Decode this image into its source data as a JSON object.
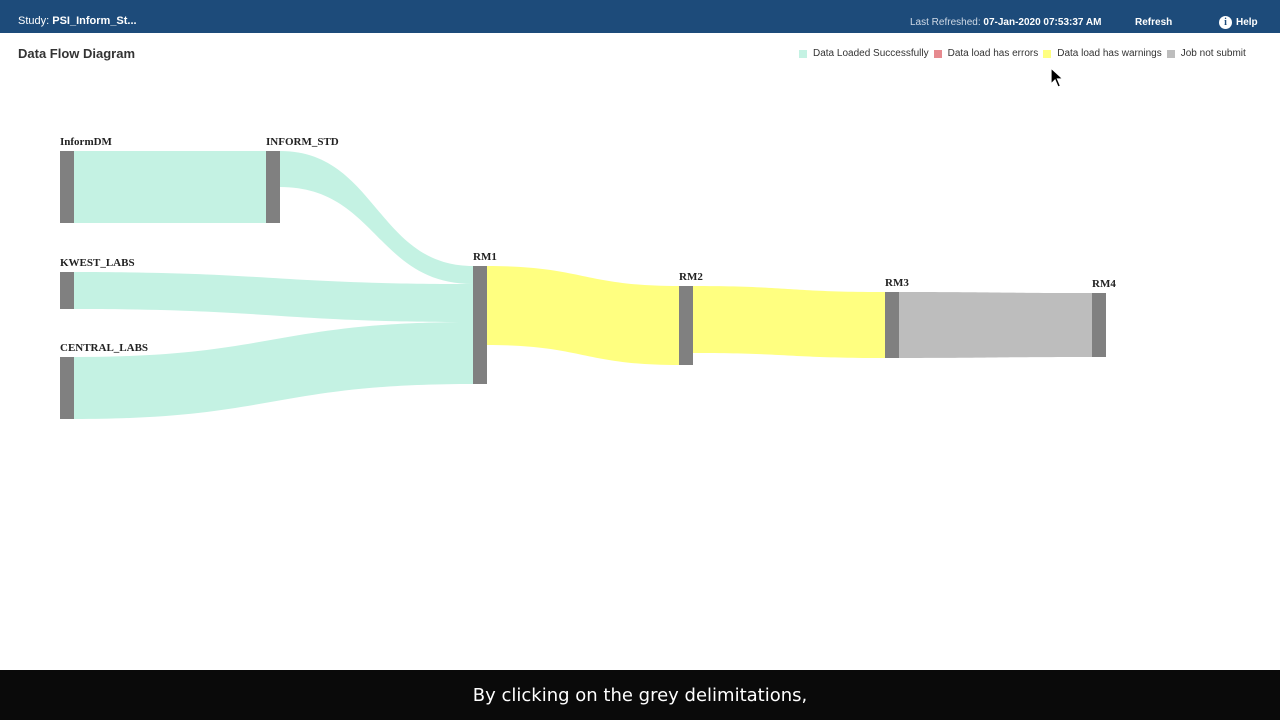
{
  "header": {
    "study_label": "Study:",
    "study_name": "PSI_Inform_St...",
    "last_refreshed_label": "Last Refreshed:",
    "last_refreshed_value": "07-Jan-2020 07:53:37 AM",
    "refresh_label": "Refresh",
    "help_label": "Help",
    "help_icon": "info-icon"
  },
  "page": {
    "title": "Data Flow Diagram"
  },
  "legend": [
    {
      "label": "Data Loaded Successfully",
      "color": "#c4f2e3"
    },
    {
      "label": "Data load has errors",
      "color": "#e68a8f"
    },
    {
      "label": "Data load has warnings",
      "color": "#ffff80"
    },
    {
      "label": "Job not submittec",
      "color": "#bdbdbd"
    }
  ],
  "diagram": {
    "node_color": "#808080",
    "nodes": [
      {
        "id": "InformDM",
        "label": "InformDM",
        "label_color": "#222222"
      },
      {
        "id": "INFORM_STD",
        "label": "INFORM_STD",
        "label_color": "#222222"
      },
      {
        "id": "KWEST_LABS",
        "label": "KWEST_LABS",
        "label_color": "#222222"
      },
      {
        "id": "CENTRAL_LABS",
        "label": "CENTRAL_LABS",
        "label_color": "#222222"
      },
      {
        "id": "RM1",
        "label": "RM1",
        "label_color": "#222222"
      },
      {
        "id": "RM2",
        "label": "RM2",
        "label_color": "#222222"
      },
      {
        "id": "RM3",
        "label": "RM3",
        "label_color": "#222222"
      },
      {
        "id": "RM4",
        "label": "RM4",
        "label_color": "#b5542f"
      }
    ],
    "links": [
      {
        "source": "InformDM",
        "target": "INFORM_STD",
        "status": "Data Loaded Successfully",
        "color": "#c4f2e3"
      },
      {
        "source": "INFORM_STD",
        "target": "RM1",
        "status": "Data Loaded Successfully",
        "color": "#c4f2e3"
      },
      {
        "source": "KWEST_LABS",
        "target": "RM1",
        "status": "Data Loaded Successfully",
        "color": "#c4f2e3"
      },
      {
        "source": "CENTRAL_LABS",
        "target": "RM1",
        "status": "Data Loaded Successfully",
        "color": "#c4f2e3"
      },
      {
        "source": "RM1",
        "target": "RM2",
        "status": "Data load has warnings",
        "color": "#ffff80"
      },
      {
        "source": "RM2",
        "target": "RM3",
        "status": "Data load has warnings",
        "color": "#ffff80"
      },
      {
        "source": "RM3",
        "target": "RM4",
        "status": "Job not submittec",
        "color": "#bdbdbd"
      }
    ]
  },
  "caption": {
    "text": "By clicking on the grey delimitations,"
  }
}
